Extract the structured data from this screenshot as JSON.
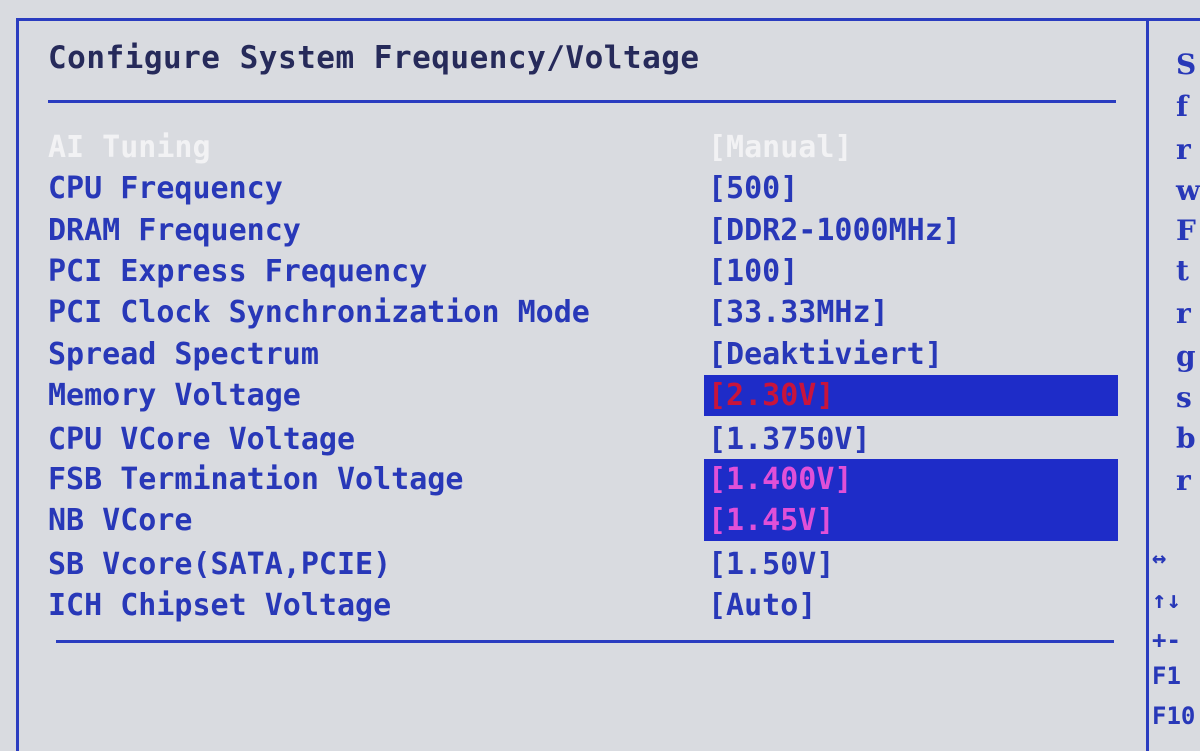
{
  "bios": {
    "title": "Configure System Frequency/Voltage",
    "settings": [
      {
        "label": "AI Tuning",
        "value": "[Manual]"
      },
      {
        "label": "CPU Frequency",
        "value": "[500]"
      },
      {
        "label": "DRAM Frequency",
        "value": "[DDR2-1000MHz]"
      },
      {
        "label": "PCI Express Frequency",
        "value": "[100]"
      },
      {
        "label": "PCI Clock Synchronization Mode",
        "value": "[33.33MHz]"
      },
      {
        "label": "Spread Spectrum",
        "value": "[Deaktiviert]"
      },
      {
        "label": "Memory Voltage",
        "value": "[2.30V]"
      },
      {
        "label": "CPU VCore Voltage",
        "value": "[1.3750V]"
      },
      {
        "label": "FSB Termination Voltage",
        "value": "[1.400V]"
      },
      {
        "label": "NB VCore",
        "value": "[1.45V]"
      },
      {
        "label": "SB Vcore(SATA,PCIE)",
        "value": "[1.50V]"
      },
      {
        "label": "ICH Chipset Voltage",
        "value": "[Auto]"
      }
    ],
    "help_panel_chars": [
      "S",
      "f",
      "r",
      "w",
      "F",
      "t",
      "r",
      "g",
      "s",
      "b",
      "r"
    ],
    "nav_keys": [
      "↔",
      "↑↓",
      "+-",
      "F1",
      "F10"
    ],
    "colors": {
      "background": "#d9dbe0",
      "text": "#2838b8",
      "highlight": "#1e2cc8",
      "warn_red": "#c8143c",
      "warn_magenta": "#e050d8",
      "active_text": "#f2f2f4"
    }
  }
}
